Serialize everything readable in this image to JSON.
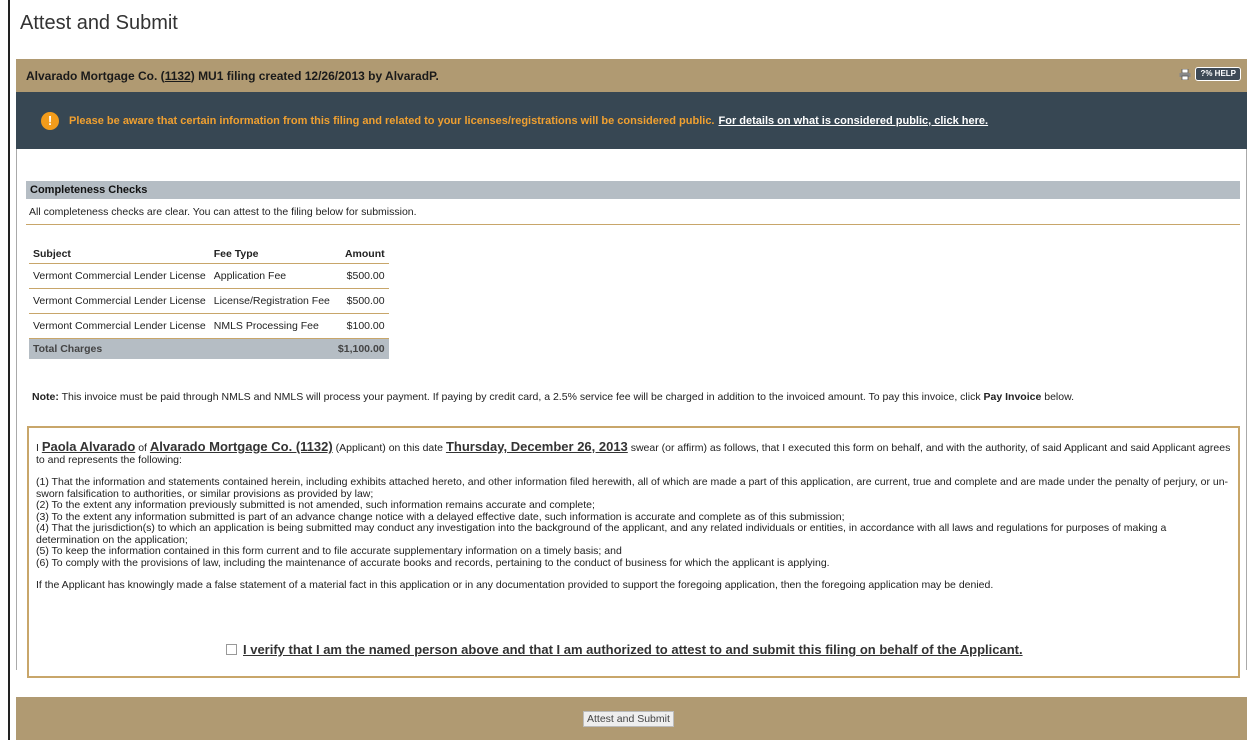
{
  "page": {
    "title": "Attest and Submit"
  },
  "filing": {
    "company": "Alvarado Mortgage Co. (",
    "company_id": "1132",
    "rest": ") MU1 filing created 12/26/2013 by AlvaradP.",
    "help_label": "?% HELP"
  },
  "notice": {
    "icon": "exclamation-icon",
    "text": "Please be aware that certain information from this filing and related to your licenses/registrations will be considered public.",
    "link": "For details on what is considered public, click here."
  },
  "completeness": {
    "title": "Completeness Checks",
    "description": "All completeness checks are clear. You can attest to the filing below for submission."
  },
  "fees": {
    "headers": [
      "Subject",
      "Fee Type",
      "Amount"
    ],
    "rows": [
      {
        "subject": "Vermont Commercial Lender License",
        "fee_type": "Application Fee",
        "amount": "$500.00"
      },
      {
        "subject": "Vermont Commercial Lender License",
        "fee_type": "License/Registration Fee",
        "amount": "$500.00"
      },
      {
        "subject": "Vermont Commercial Lender License",
        "fee_type": "NMLS Processing Fee",
        "amount": "$100.00"
      }
    ],
    "total_label": "Total Charges",
    "total_amount": "$1,100.00"
  },
  "note": {
    "label": "Note:",
    "text": "This invoice must be paid through NMLS and NMLS will process your payment. If paying by credit card, a 2.5% service fee will be charged in addition to the invoiced amount. To pay this invoice, click",
    "bold": "Pay Invoice",
    "end": "below."
  },
  "attestation": {
    "i": "I",
    "name": "Paola Alvarado",
    "of": "of",
    "company": "Alvarado Mortgage Co. (1132)",
    "applicant_date": "(Applicant) on this date",
    "date": "Thursday, December 26, 2013",
    "swear": "swear (or affirm) as follows, that I executed this form on behalf, and with the authority, of said Applicant and said Applicant agrees to and represents the following:",
    "items": [
      "(1) That the information and statements contained herein, including exhibits attached hereto, and other information filed herewith, all of which are made a part of this application, are current, true and complete and are made under the penalty of perjury, or un-sworn falsification to authorities, or similar provisions as provided by law;",
      "(2) To the extent any information previously submitted is not amended, such information remains accurate and complete;",
      "(3) To the extent any information submitted is part of an advance change notice with a delayed effective date, such information is accurate and complete as of this submission;",
      "(4) That the jurisdiction(s) to which an application is being submitted may conduct any investigation into the background of the applicant, and any related individuals or entities, in accordance with all laws and regulations for purposes of making a determination on the application;",
      "(5) To keep the information contained in this form current and to file accurate supplementary information on a timely basis; and",
      "(6) To comply with the provisions of law, including the maintenance of accurate books and records, pertaining to the conduct of business for which the applicant is applying."
    ],
    "false_statement": "If the Applicant has knowingly made a false statement of a material fact in this application or in any documentation provided to support the foregoing application, then the foregoing application may be denied.",
    "verify_label": "I verify that I am the named person above and that I am authorized to attest to and submit this filing on behalf of the Applicant."
  },
  "submit": {
    "label": "Attest and Submit"
  }
}
